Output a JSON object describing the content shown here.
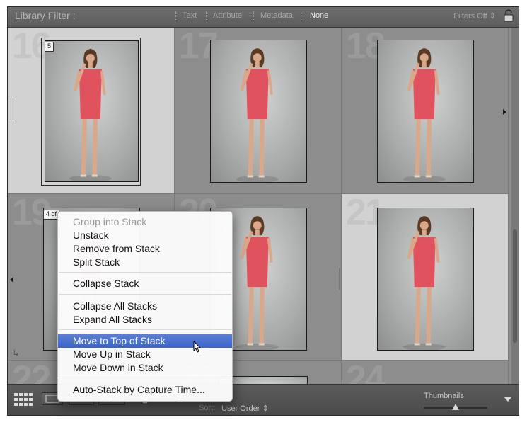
{
  "filter_bar": {
    "title": "Library Filter :",
    "tabs": [
      "Text",
      "Attribute",
      "Metadata",
      "None"
    ],
    "active_tab": "None",
    "filters_status": "Filters Off",
    "lock_icon": "padlock-icon"
  },
  "grid": {
    "cells": [
      {
        "number": "16",
        "selected": true,
        "badge": "5"
      },
      {
        "number": "17",
        "selected": false,
        "badge": ""
      },
      {
        "number": "18",
        "selected": false,
        "badge": ""
      },
      {
        "number": "19",
        "selected": false,
        "badge": "4 of"
      },
      {
        "number": "20",
        "selected": false,
        "badge": ""
      },
      {
        "number": "21",
        "selected": true,
        "badge": ""
      },
      {
        "number": "22",
        "selected": false,
        "badge": ""
      },
      {
        "number": "23",
        "selected": false,
        "badge": ""
      },
      {
        "number": "24",
        "selected": false,
        "badge": ""
      }
    ]
  },
  "context_menu": {
    "items": [
      {
        "label": "Group into Stack",
        "disabled": true
      },
      {
        "label": "Unstack",
        "disabled": false
      },
      {
        "label": "Remove from Stack",
        "disabled": false
      },
      {
        "label": "Split Stack",
        "disabled": false
      },
      {
        "label": "Collapse Stack",
        "disabled": false
      },
      {
        "label": "Collapse All Stacks",
        "disabled": false
      },
      {
        "label": "Expand All Stacks",
        "disabled": false
      },
      {
        "label": "Move to Top of Stack",
        "disabled": false,
        "highlighted": true
      },
      {
        "label": "Move Up in Stack",
        "disabled": false
      },
      {
        "label": "Move Down in Stack",
        "disabled": false
      },
      {
        "label": "Auto-Stack by Capture Time...",
        "disabled": false
      }
    ]
  },
  "toolbar": {
    "sort_label": "Sort:",
    "sort_value": "User Order",
    "thumbnails_label": "Thumbnails",
    "thumbnail_size": 0.5
  },
  "colors": {
    "menu_highlight": "#3a64c6",
    "dress": "#e0525e",
    "selected_cell": "#d2d2d2"
  }
}
